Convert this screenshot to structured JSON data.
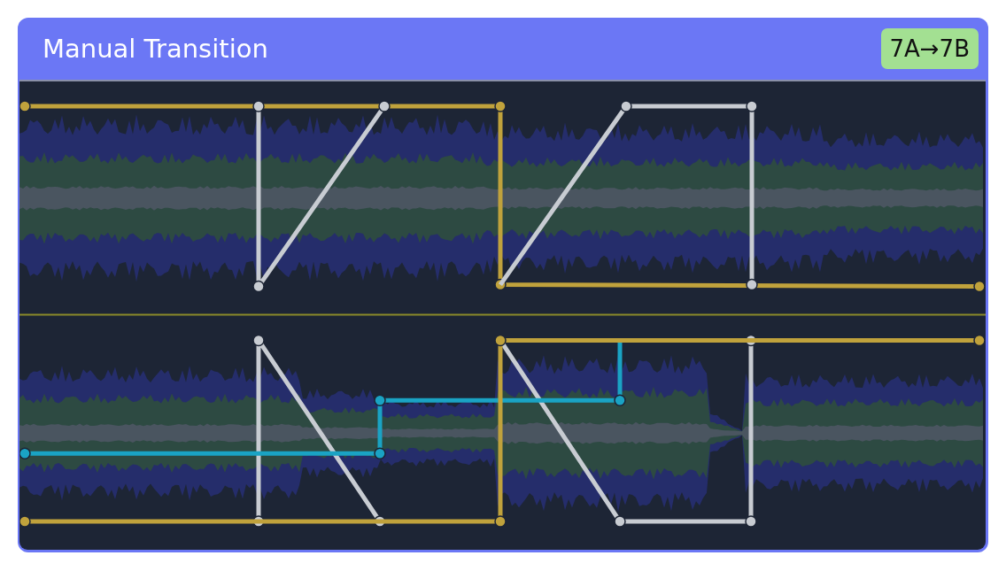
{
  "header": {
    "title": "Manual Transition",
    "badge": "7A→7B"
  }
}
